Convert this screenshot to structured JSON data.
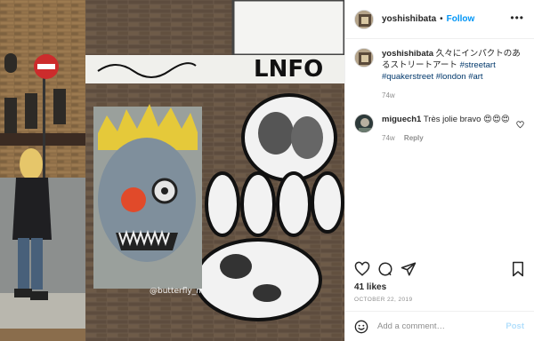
{
  "header": {
    "username": "yoshishibata",
    "separator": "•",
    "follow_label": "Follow",
    "more_label": "•••"
  },
  "caption": {
    "username": "yoshishibata",
    "text_prefix": "久々にインパクトのあるストリートアート",
    "hashtags": [
      "#streetart",
      "#quakerstreet",
      "#london",
      "#art"
    ],
    "age": "74w"
  },
  "comments": [
    {
      "username": "miguech1",
      "text": "Très jolie bravo 😍😍😍",
      "age": "74w",
      "reply_label": "Reply"
    }
  ],
  "actions": {
    "like_icon": "heart-icon",
    "comment_icon": "comment-icon",
    "share_icon": "paper-plane-icon",
    "save_icon": "bookmark-icon"
  },
  "likes_text": "41 likes",
  "date_text": "OCTOBER 22, 2019",
  "add_comment": {
    "emoji_icon": "smiley-icon",
    "placeholder": "Add a comment…",
    "post_label": "Post"
  },
  "photo": {
    "wall_text_top": "LNFO",
    "artist_tag": "@butterfly_ma"
  },
  "colors": {
    "follow_blue": "#0095f6",
    "post_disabled": "#b2dffc",
    "hashtag": "#00376b",
    "muted": "#8e8e8e"
  }
}
